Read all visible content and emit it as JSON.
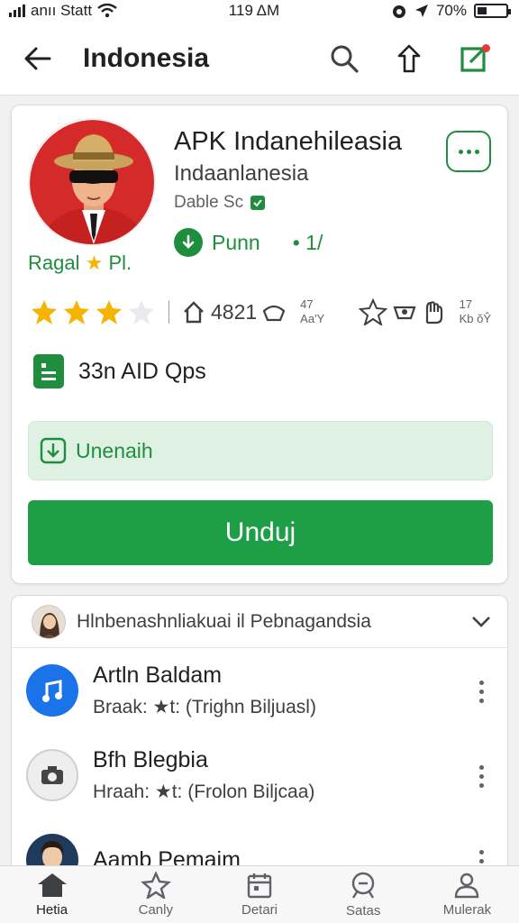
{
  "status_bar": {
    "carrier": "anıı Statt",
    "time": "119 ΔM",
    "battery": "70%"
  },
  "app_bar": {
    "title": "Indonesia"
  },
  "app": {
    "name": "APK Indanehileasia",
    "subtitle": "Indaanlanesia",
    "developer": "Dable Sc",
    "tag": "Ragal",
    "tag_suffix": "Pl.",
    "install_label": "Punn",
    "install_extra": "• 1/"
  },
  "stats": {
    "rating": 3,
    "reviews": "4821",
    "reviews_sub_top": "47",
    "reviews_sub_bottom": "Aa'Y",
    "right_sub_top": "17",
    "right_sub_bottom": "Kb ŏŶ"
  },
  "size_text": "33n AID Qps",
  "update_label": "Unenaih",
  "download_label": "Unduj",
  "list": {
    "header": "Hlnbenashnliakuai il Pebnagandsia",
    "items": [
      {
        "title": "Artln Baldam",
        "sub": "Braak: ★t: (Trighn Biljuasl)"
      },
      {
        "title": "Bfh Blegbia",
        "sub": "Hraah: ★t: (Frolon Biljcaa)"
      },
      {
        "title": "Aamb Pemaim",
        "sub": ""
      }
    ]
  },
  "nav": {
    "items": [
      "Hetia",
      "Canly",
      "Detari",
      "Satas",
      "Mulerak"
    ]
  },
  "colors": {
    "accent": "#1e8e3e",
    "button": "#1e9e47",
    "star": "#f4b400"
  }
}
